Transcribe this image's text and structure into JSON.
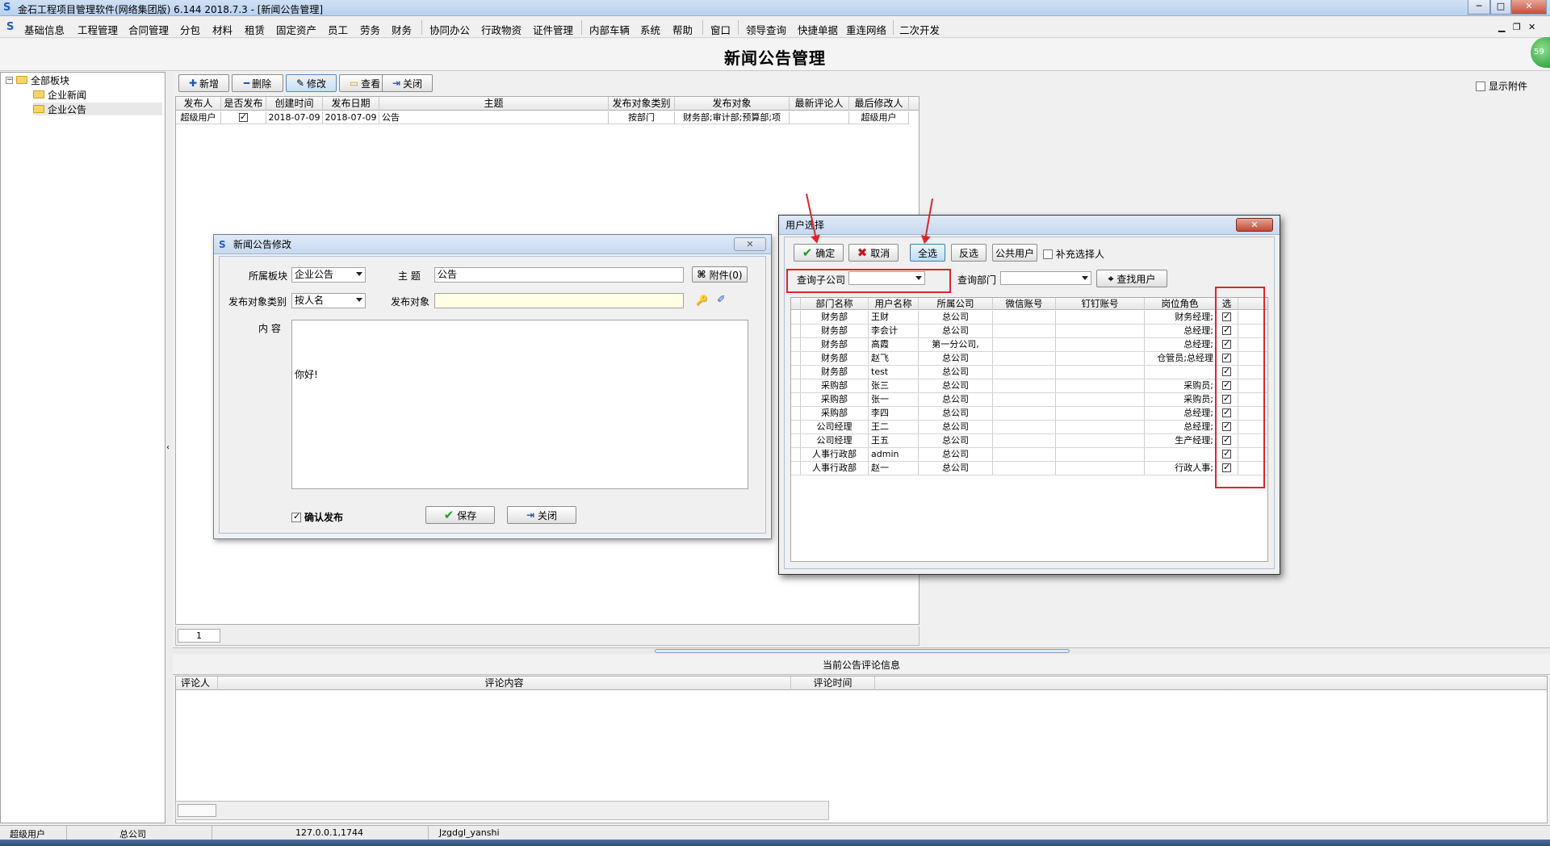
{
  "window": {
    "title": "金石工程项目管理软件(网络集团版) 6.144  2018.7.3 - [新闻公告管理]",
    "minimize": "─",
    "restore": "□",
    "close": "✕"
  },
  "menu": {
    "items": [
      "基础信息",
      "工程管理",
      "合同管理",
      "分包",
      "材料",
      "租赁",
      "固定资产",
      "员工",
      "劳务",
      "财务",
      "协同办公",
      "行政物资",
      "证件管理",
      "内部车辆",
      "系统",
      "帮助",
      "窗口",
      "领导查询",
      "快捷单据",
      "重连网络",
      "二次开发"
    ],
    "mdi_min": "▁",
    "mdi_restore": "❐",
    "mdi_close": "✕"
  },
  "page": {
    "title": "新闻公告管理",
    "badge": "59"
  },
  "tree": {
    "root": "全部板块",
    "children": [
      "企业新闻",
      "企业公告"
    ]
  },
  "toolbar": {
    "add": "新增",
    "delete": "删除",
    "edit": "修改",
    "view": "查看",
    "close": "关闭",
    "show_attachment": "显示附件"
  },
  "main_grid": {
    "columns": [
      "发布人",
      "是否发布",
      "创建时间",
      "发布日期",
      "主题",
      "发布对象类别",
      "发布对象",
      "最新评论人",
      "最后修改人"
    ],
    "rows": [
      {
        "publisher": "超级用户",
        "published": true,
        "created": "2018-07-09",
        "publish_date": "2018-07-09",
        "subject": "公告",
        "target_type": "按部门",
        "target": "财务部;审计部;预算部;项",
        "last_commenter": "",
        "last_modifier": "超级用户"
      }
    ],
    "page": "1"
  },
  "comments": {
    "title": "当前公告评论信息",
    "columns": [
      "评论人",
      "评论内容",
      "评论时间"
    ]
  },
  "status": {
    "user": "超级用户",
    "company": "总公司",
    "address": "127.0.0.1,1744",
    "db": "Jzgdgl_yanshi"
  },
  "news_dialog": {
    "title": "新闻公告修改",
    "close": "✕",
    "board_label": "所属板块",
    "board_value": "企业公告",
    "subject_label": "主  题",
    "subject_value": "公告",
    "attachment": "附件(0)",
    "target_type_label": "发布对象类别",
    "target_type_value": "按人名",
    "target_label": "发布对象",
    "target_value": "",
    "content_label": "内  容",
    "content_value": "你好!",
    "confirm_publish": "确认发布",
    "confirm_checked": true,
    "save": "保存",
    "close_btn": "关闭"
  },
  "user_dialog": {
    "title": "用户选择",
    "close": "✕",
    "ok": "确定",
    "cancel": "取消",
    "select_all": "全选",
    "invert": "反选",
    "public_users": "公共用户",
    "supplement": "补充选择人",
    "sub_company_label": "查询子公司",
    "sub_company_value": "",
    "dept_label": "查询部门",
    "dept_value": "",
    "find_user": "查找用户",
    "columns": [
      "部门名称",
      "用户名称",
      "所属公司",
      "微信账号",
      "钉钉账号",
      "岗位角色",
      "选"
    ],
    "rows": [
      {
        "dept": "财务部",
        "user": "王财",
        "company": "总公司",
        "wechat": "",
        "dingtalk": "",
        "role": "财务经理;",
        "sel": true
      },
      {
        "dept": "财务部",
        "user": "李会计",
        "company": "总公司",
        "wechat": "",
        "dingtalk": "",
        "role": "总经理;",
        "sel": true
      },
      {
        "dept": "财务部",
        "user": "高霞",
        "company": "第一分公司,",
        "wechat": "",
        "dingtalk": "",
        "role": "总经理;",
        "sel": true
      },
      {
        "dept": "财务部",
        "user": "赵飞",
        "company": "总公司",
        "wechat": "",
        "dingtalk": "",
        "role": "仓管员;总经理",
        "sel": true
      },
      {
        "dept": "财务部",
        "user": "test",
        "company": "总公司",
        "wechat": "",
        "dingtalk": "",
        "role": "",
        "sel": true
      },
      {
        "dept": "采购部",
        "user": "张三",
        "company": "总公司",
        "wechat": "",
        "dingtalk": "",
        "role": "采购员;",
        "sel": true
      },
      {
        "dept": "采购部",
        "user": "张一",
        "company": "总公司",
        "wechat": "",
        "dingtalk": "",
        "role": "采购员;",
        "sel": true
      },
      {
        "dept": "采购部",
        "user": "李四",
        "company": "总公司",
        "wechat": "",
        "dingtalk": "",
        "role": "总经理;",
        "sel": true
      },
      {
        "dept": "公司经理",
        "user": "王二",
        "company": "总公司",
        "wechat": "",
        "dingtalk": "",
        "role": "总经理;",
        "sel": true
      },
      {
        "dept": "公司经理",
        "user": "王五",
        "company": "总公司",
        "wechat": "",
        "dingtalk": "",
        "role": "生产经理;",
        "sel": true
      },
      {
        "dept": "人事行政部",
        "user": "admin",
        "company": "总公司",
        "wechat": "",
        "dingtalk": "",
        "role": "",
        "sel": true
      },
      {
        "dept": "人事行政部",
        "user": "赵一",
        "company": "总公司",
        "wechat": "",
        "dingtalk": "",
        "role": "行政人事;",
        "sel": true
      }
    ]
  },
  "colors": {
    "highlight": "#e0242a",
    "title_bar": "#c7d9ef"
  }
}
